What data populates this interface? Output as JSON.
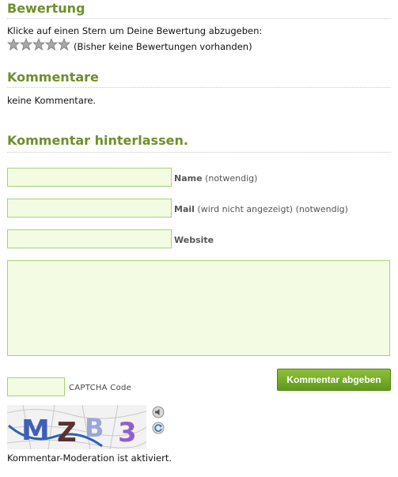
{
  "rating": {
    "heading": "Bewertung",
    "prompt": "Klicke auf einen Stern um Deine Bewertung abzugeben:",
    "stars": 5,
    "note": "(Bisher keine Bewertungen vorhanden)"
  },
  "comments": {
    "heading": "Kommentare",
    "empty": "keine Kommentare."
  },
  "form": {
    "heading": "Kommentar hinterlassen.",
    "name_label": "Name",
    "name_hint": "(notwendig)",
    "mail_label": "Mail",
    "mail_hint": "(wird nicht angezeigt) (notwendig)",
    "website_label": "Website",
    "captcha_label": "CAPTCHA Code",
    "captcha_text": "MZB3",
    "submit_label": "Kommentar abgeben",
    "moderation_note": "Kommentar-Moderation ist aktiviert."
  }
}
